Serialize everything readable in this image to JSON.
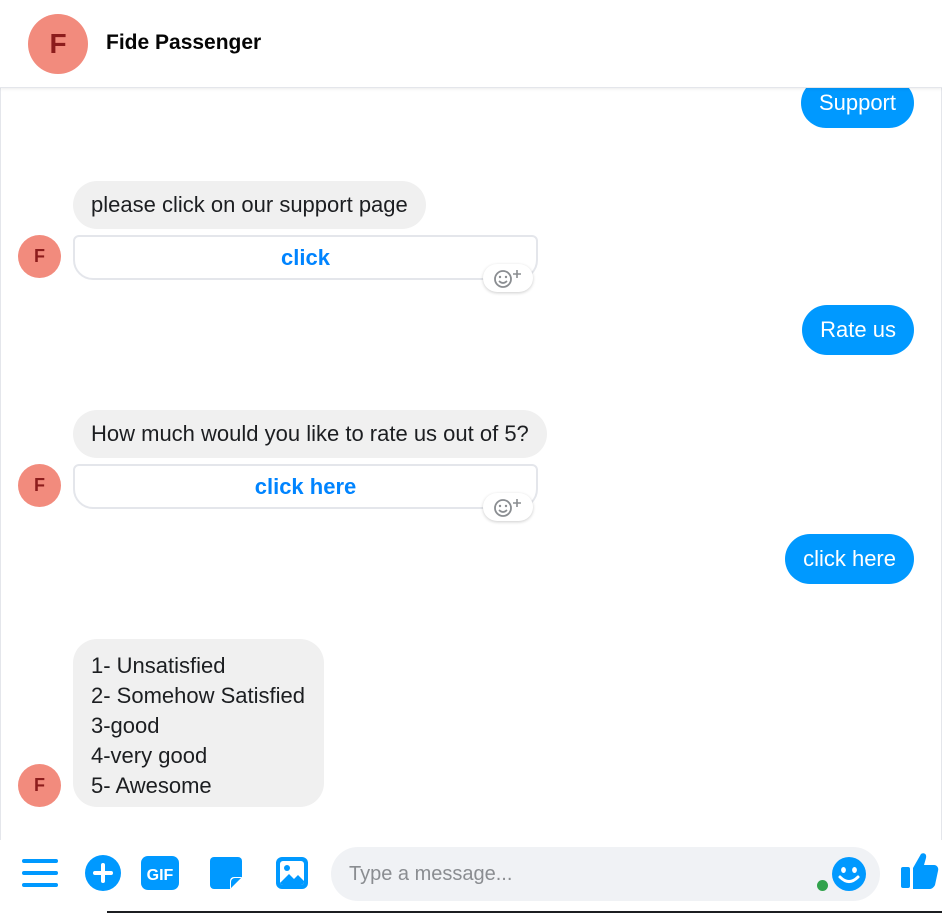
{
  "header": {
    "avatar_letter": "F",
    "title": "Fide Passenger"
  },
  "messages": {
    "out_support": "Support",
    "in_support_text": "please click on our support page",
    "in_support_button": "click",
    "out_rate": "Rate us",
    "in_rate_text": "How much would you like to rate us out of 5?",
    "in_rate_button": "click here",
    "out_click_here": "click here",
    "rating_options": [
      "1- Unsatisfied",
      "2- Somehow Satisfied",
      "3-good",
      "4-very good",
      "5- Awesome"
    ],
    "avatar_letter": "F"
  },
  "composer": {
    "placeholder": "Type a message...",
    "icons": [
      "menu-icon",
      "plus-icon",
      "gif-icon",
      "sticker-icon",
      "image-icon",
      "emoji-icon",
      "thumbs-up-icon"
    ]
  },
  "colors": {
    "accent": "#0099ff",
    "link": "#0084ff",
    "avatar_bg": "#f28b7d",
    "avatar_fg": "#8c1c1c",
    "incoming_bg": "#f0f0f0"
  }
}
